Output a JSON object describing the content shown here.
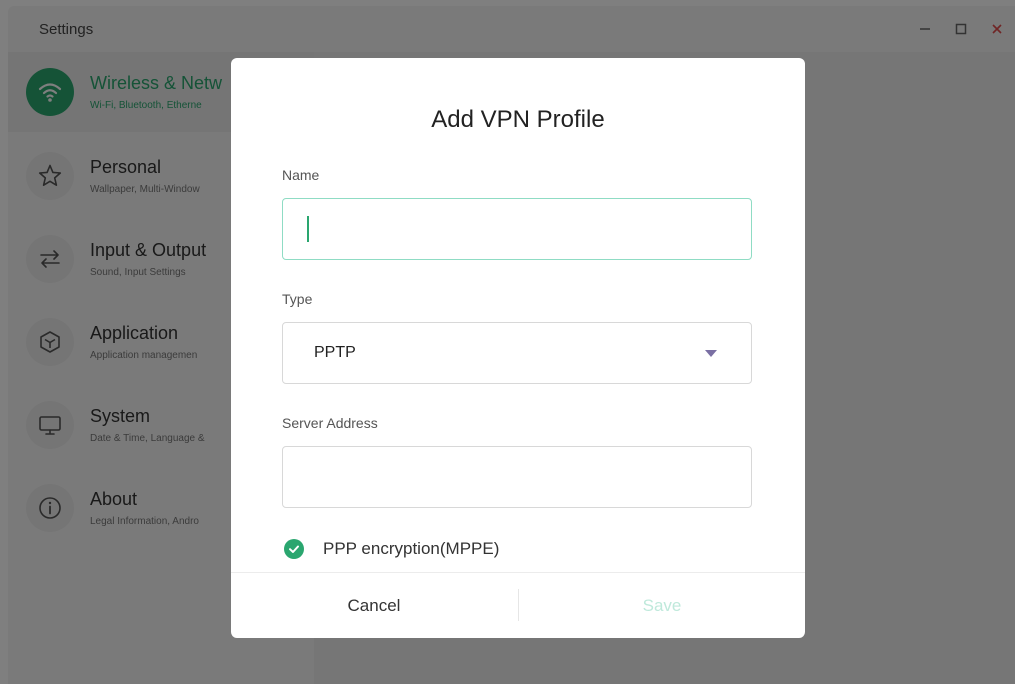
{
  "window": {
    "title": "Settings",
    "controls": [
      "minimize-icon",
      "maximize-icon",
      "close-icon"
    ]
  },
  "sidebar": {
    "items": [
      {
        "label": "Wireless & Netw",
        "subtitle": "Wi-Fi, Bluetooth, Etherne",
        "icon": "wifi-icon",
        "active": true
      },
      {
        "label": "Personal",
        "subtitle": "Wallpaper, Multi-Window",
        "icon": "star-icon"
      },
      {
        "label": "Input & Output",
        "subtitle": "Sound, Input Settings",
        "icon": "swap-arrows-icon"
      },
      {
        "label": "Application",
        "subtitle": "Application managemen",
        "icon": "cube-icon"
      },
      {
        "label": "System",
        "subtitle": "Date & Time, Language &",
        "icon": "monitor-icon"
      },
      {
        "label": "About",
        "subtitle": "Legal Information, Andro",
        "icon": "info-icon"
      }
    ]
  },
  "dialog": {
    "title": "Add VPN Profile",
    "name_label": "Name",
    "name_value": "",
    "type_label": "Type",
    "type_value": "PPTP",
    "server_label": "Server Address",
    "server_value": "",
    "encryption_label": "PPP encryption(MPPE)",
    "encryption_checked": true,
    "cancel_label": "Cancel",
    "save_label": "Save"
  },
  "colors": {
    "accent": "#2aa66f",
    "focus_border": "#8fdcc4",
    "save_disabled": "#bfe9db",
    "dropdown_arrow": "#7a6fa3"
  }
}
